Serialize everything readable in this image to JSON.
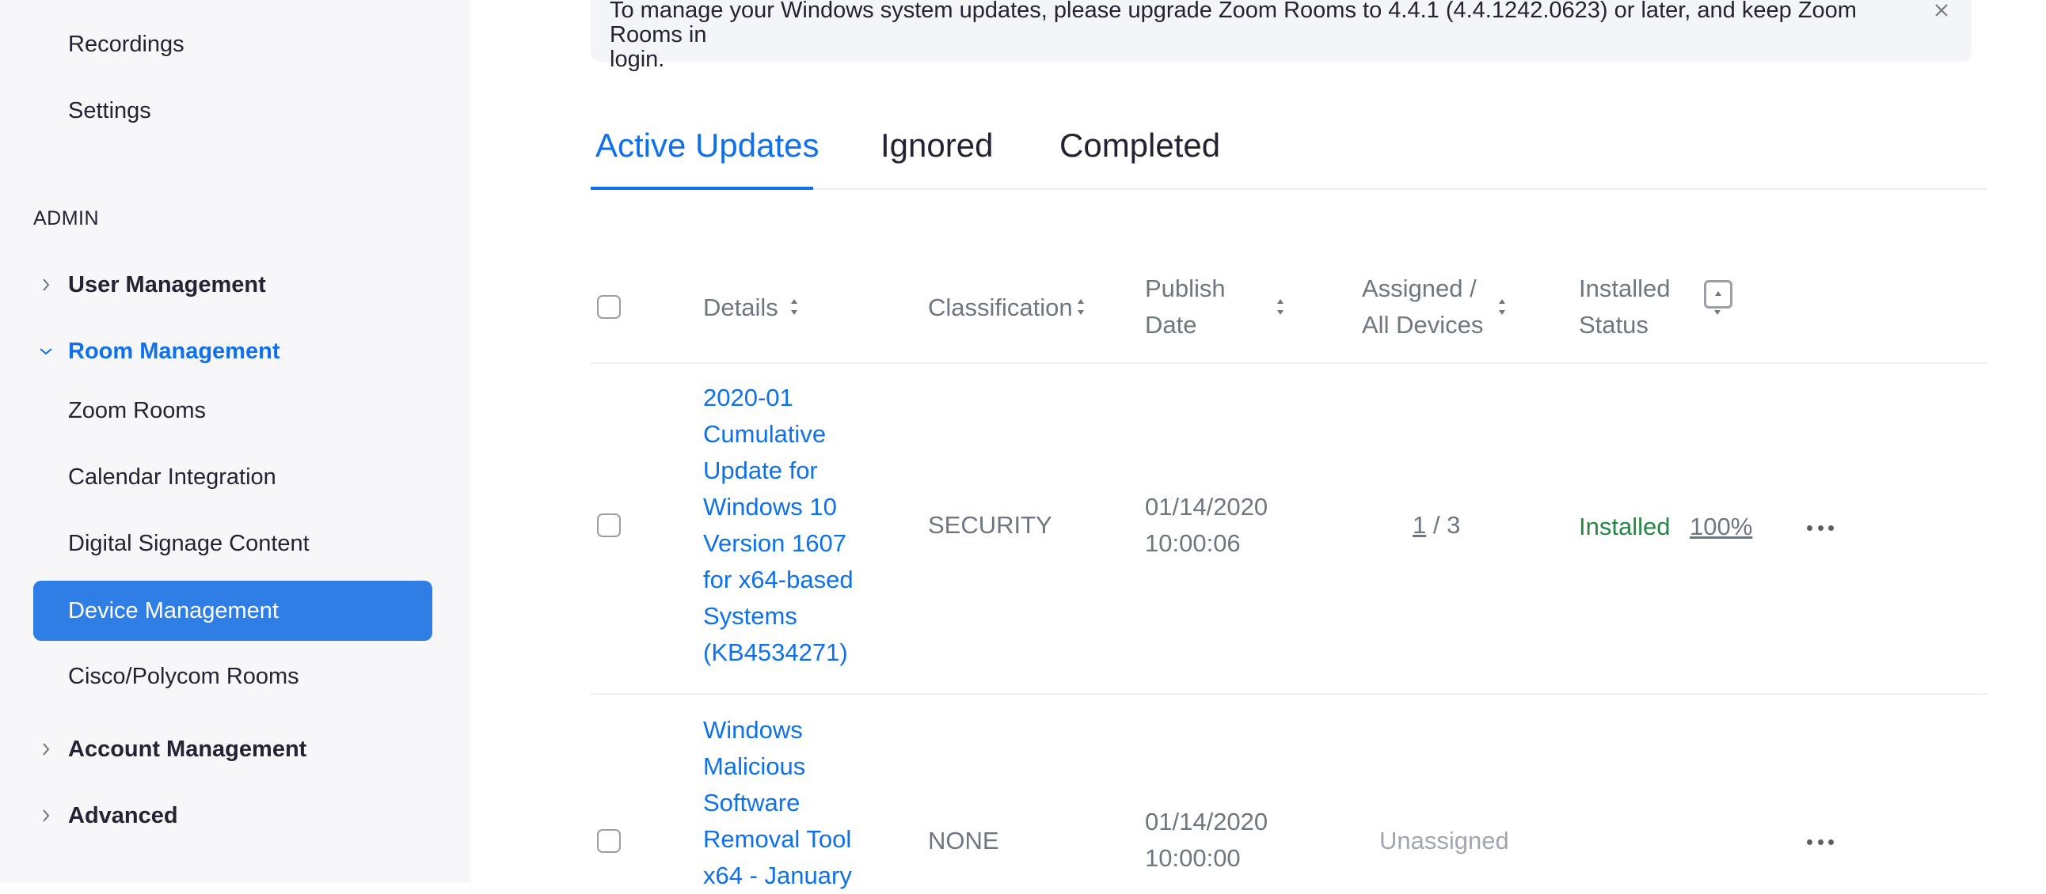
{
  "sidebar": {
    "recordings": "Recordings",
    "settings": "Settings",
    "admin_label": "ADMIN",
    "user_management": "User Management",
    "room_management": "Room Management",
    "zoom_rooms": "Zoom Rooms",
    "calendar_integration": "Calendar Integration",
    "digital_signage": "Digital Signage Content",
    "device_management": "Device Management",
    "cisco_polycom": "Cisco/Polycom Rooms",
    "account_management": "Account Management",
    "advanced": "Advanced"
  },
  "banner": {
    "line1": "To manage your Windows system updates, please upgrade Zoom Rooms to 4.4.1 (4.4.1242.0623) or later, and keep Zoom Rooms in",
    "line2": "login."
  },
  "tabs": {
    "active": "Active Updates",
    "ignored": "Ignored",
    "completed": "Completed"
  },
  "table": {
    "headers": {
      "details": "Details",
      "classification": "Classification",
      "publish_line1": "Publish",
      "publish_line2": "Date",
      "assigned_line1": "Assigned /",
      "assigned_line2": "All Devices",
      "installed_line1": "Installed",
      "installed_line2": "Status"
    },
    "rows": [
      {
        "details_lines": [
          "2020-01",
          "Cumulative",
          "Update for",
          "Windows 10",
          "Version 1607",
          "for x64-based",
          "Systems",
          "(KB4534271)"
        ],
        "classification": "SECURITY",
        "publish_date": "01/14/2020",
        "publish_time": "10:00:06",
        "assigned": "1",
        "all_devices": "/ 3",
        "status": "Installed",
        "percent": "100%"
      },
      {
        "details_lines": [
          "Windows",
          "Malicious",
          "Software",
          "Removal Tool",
          "x64 - January"
        ],
        "classification": "NONE",
        "publish_date": "01/14/2020",
        "publish_time": "10:00:00",
        "assigned_text": "Unassigned"
      }
    ]
  },
  "colors": {
    "accent": "#0e71eb",
    "active_nav_bg": "#2f7ee6",
    "installed_green": "#268543"
  }
}
